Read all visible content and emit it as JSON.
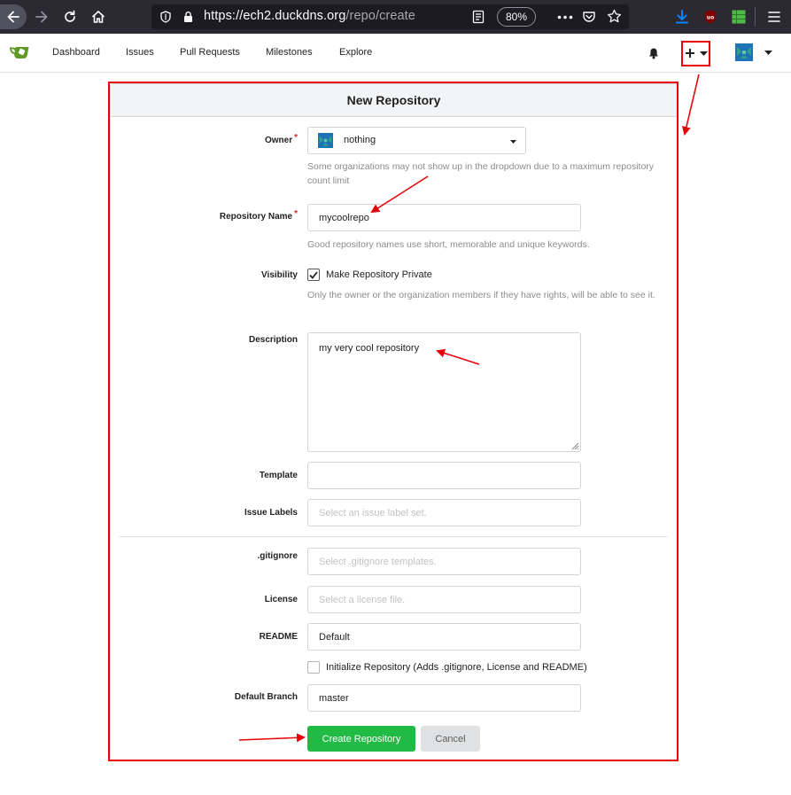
{
  "browser": {
    "url_host": "https://ech2.duckdns.org",
    "url_path": "/repo/create",
    "zoom": "80%"
  },
  "navbar": {
    "items": [
      "Dashboard",
      "Issues",
      "Pull Requests",
      "Milestones",
      "Explore"
    ]
  },
  "form": {
    "title": "New Repository",
    "owner": {
      "label": "Owner",
      "value": "nothing",
      "help": "Some organizations may not show up in the dropdown due to a maximum repository count limit"
    },
    "repo_name": {
      "label": "Repository Name",
      "value": "mycoolrepo",
      "help": "Good repository names use short, memorable and unique keywords."
    },
    "visibility": {
      "label": "Visibility",
      "checkbox_label": "Make Repository Private",
      "checked": true,
      "help": "Only the owner or the organization members if they have rights, will be able to see it."
    },
    "description": {
      "label": "Description",
      "value": "my very cool repository"
    },
    "template": {
      "label": "Template",
      "value": ""
    },
    "issue_labels": {
      "label": "Issue Labels",
      "placeholder": "Select an issue label set."
    },
    "gitignore": {
      "label": ".gitignore",
      "placeholder": "Select .gitignore templates."
    },
    "license": {
      "label": "License",
      "placeholder": "Select a license file."
    },
    "readme": {
      "label": "README",
      "value": "Default"
    },
    "init": {
      "label": "Initialize Repository (Adds .gitignore, License and README)",
      "checked": false
    },
    "default_branch": {
      "label": "Default Branch",
      "value": "master"
    },
    "create_label": "Create Repository",
    "cancel_label": "Cancel"
  },
  "colors": {
    "primary_button": "#21ba45",
    "annotation": "#e8000b",
    "required_star": "#db2828"
  },
  "icons": [
    "back-icon",
    "forward-icon",
    "reload-icon",
    "home-icon",
    "shield-icon",
    "lock-icon",
    "reader-icon",
    "more-icon",
    "pocket-icon",
    "star-icon",
    "download-icon",
    "ublock-icon",
    "extension-icon",
    "menu-icon",
    "gitea-logo",
    "bell-icon",
    "plus-icon",
    "caret-down-icon",
    "avatar",
    "check-icon"
  ]
}
